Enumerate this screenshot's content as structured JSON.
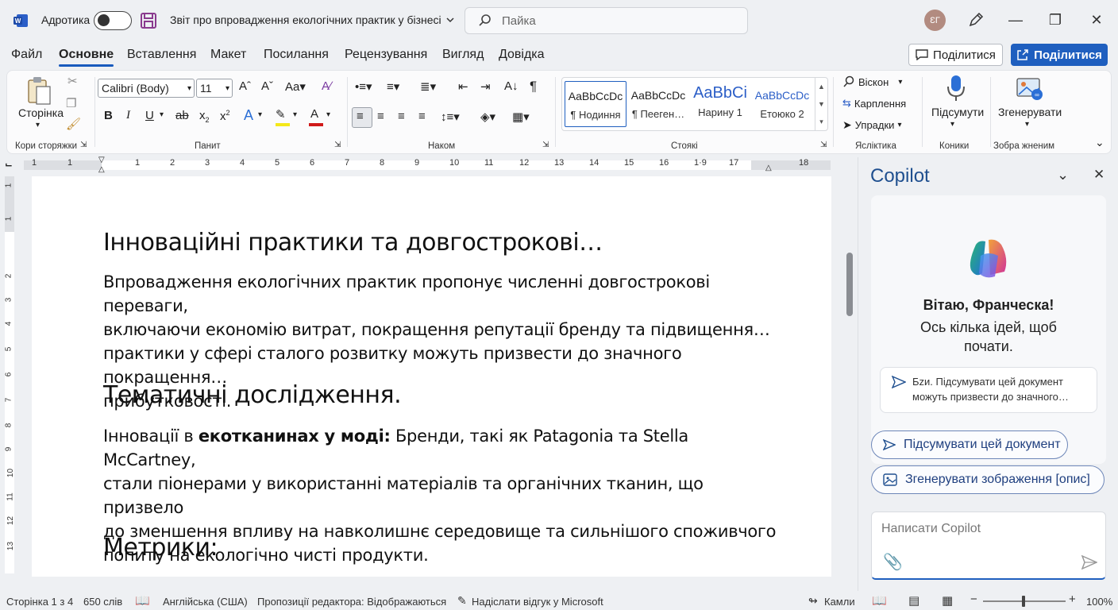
{
  "titlebar": {
    "autosave_label": "Адротика",
    "document_title": "Звіт про впровадження екологічних практик у бізнесі",
    "search_placeholder": "Пайка",
    "avatar_initials": "ƐГ"
  },
  "menu": {
    "tabs": [
      "Файл",
      "Основне",
      "Вставлення",
      "Макет",
      "Посилання",
      "Рецензування",
      "Вигляд",
      "Довідка"
    ],
    "active_tab": "Основне",
    "share_outline_label": "Поділитися",
    "share_filled_label": "Поділитися"
  },
  "ribbon": {
    "clipboard": {
      "paste_label_1": "Сторінка",
      "paste_label_2": "▾",
      "group_label": "Кори сторяжки"
    },
    "font": {
      "font_name": "Calibri (Body)",
      "font_size": "11",
      "group_label": "Панит"
    },
    "paragraph": {
      "group_label": "Наком"
    },
    "styles": {
      "group_label": "Стоякі",
      "items": [
        {
          "sample": "AaBbCcDc",
          "name": "¶ Нодиння"
        },
        {
          "sample": "AaBbCcDc",
          "name": "¶ Пееген…"
        },
        {
          "sample": "AaBbCi",
          "name": "Нарину 1"
        },
        {
          "sample": "AaBbCcDc",
          "name": "Етоюко 2"
        }
      ]
    },
    "editing": {
      "find": "Віскон",
      "replace": "Карплення",
      "select": "Упрадки",
      "group_label": "Ясліктика"
    },
    "voice": {
      "label": "Підсумути",
      "group_label": "Коники"
    },
    "designer": {
      "label": "Згенерувати",
      "group_label": "Зобра жненим"
    }
  },
  "ruler": {
    "h_labels": [
      "1",
      "1",
      "1",
      "2",
      "3",
      "4",
      "5",
      "6",
      "7",
      "8",
      "9",
      "10",
      "11",
      "12",
      "13",
      "14",
      "15",
      "16",
      "1·9",
      "17",
      "18"
    ],
    "v_labels": [
      "1",
      "1",
      "2",
      "3",
      "4",
      "5",
      "6",
      "7",
      "8",
      "9",
      "10",
      "11",
      "12",
      "13"
    ]
  },
  "document": {
    "heading1": "Інноваційні практики та довгострокові…",
    "para1_lines": [
      "Впровадження екологічних практик пропонує численні довгострокові переваги,",
      "включаючи економію витрат, покращення репутації бренду та підвищення…",
      "практики у сфері сталого розвитку можуть призвести до значного покращення…",
      "прибутковості."
    ],
    "heading2": "Тематичні дослідження.",
    "para2_prefix": "Інновації в ",
    "para2_bold": "екотканинах у моді:",
    "para2_line1_rest": " Бренди, такі як Patagonia та Stella McCartney,",
    "para2_lines": [
      "стали піонерами у використанні матеріалів та органічних тканин, що призвело",
      "до зменшення впливу на навколишнє середовище та сильнішого споживчого",
      "попиту на екологічно чисті продукти."
    ],
    "heading3": "Метрики:"
  },
  "copilot": {
    "title": "Copilot",
    "greeting": "Вітаю, Франческа!",
    "subtitle_line1": "Ось кілька ідей, щоб",
    "subtitle_line2": "почати.",
    "suggestion_line1": "Бzи. Підсумувати цей документ",
    "suggestion_line2": "можуть призвести до значного…",
    "chip_summarize": "Підсумувати цей документ",
    "chip_generate_image": "Згенерувати зображення [опис]",
    "input_placeholder": "Написати Copilot"
  },
  "statusbar": {
    "page": "Сторінка 1 з 4",
    "words": "650 слів",
    "language": "Англійська (США)",
    "editor": "Пропозиції редактора: Відображаються",
    "feedback": "Надіслати відгук у Microsoft",
    "focus": "Камли",
    "zoom": "100%"
  },
  "colors": {
    "accent": "#1f5fbf",
    "copilot_title": "#1f4f8f",
    "background": "#eef0f3"
  }
}
